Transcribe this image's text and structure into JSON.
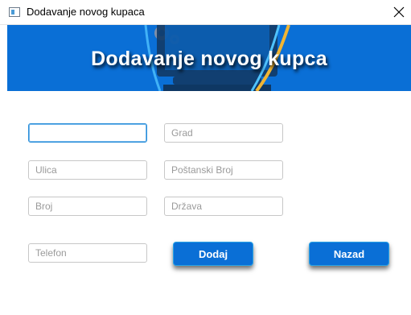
{
  "window": {
    "title": "Dodavanje novog kupaca"
  },
  "banner": {
    "title": "Dodavanje novog kupca"
  },
  "form": {
    "grad": {
      "placeholder": "Grad",
      "value": ""
    },
    "ulica": {
      "placeholder": "Ulica",
      "value": ""
    },
    "postanski_broj": {
      "placeholder": "Poštanski Broj",
      "value": ""
    },
    "broj": {
      "placeholder": "Broj",
      "value": ""
    },
    "drzava": {
      "placeholder": "Država",
      "value": ""
    },
    "telefon": {
      "placeholder": "Telefon",
      "value": ""
    },
    "first": {
      "placeholder": "",
      "value": ""
    }
  },
  "buttons": {
    "add": "Dodaj",
    "back": "Nazad"
  },
  "colors": {
    "accent": "#0a6fd6",
    "focus": "#2b8fd9"
  }
}
